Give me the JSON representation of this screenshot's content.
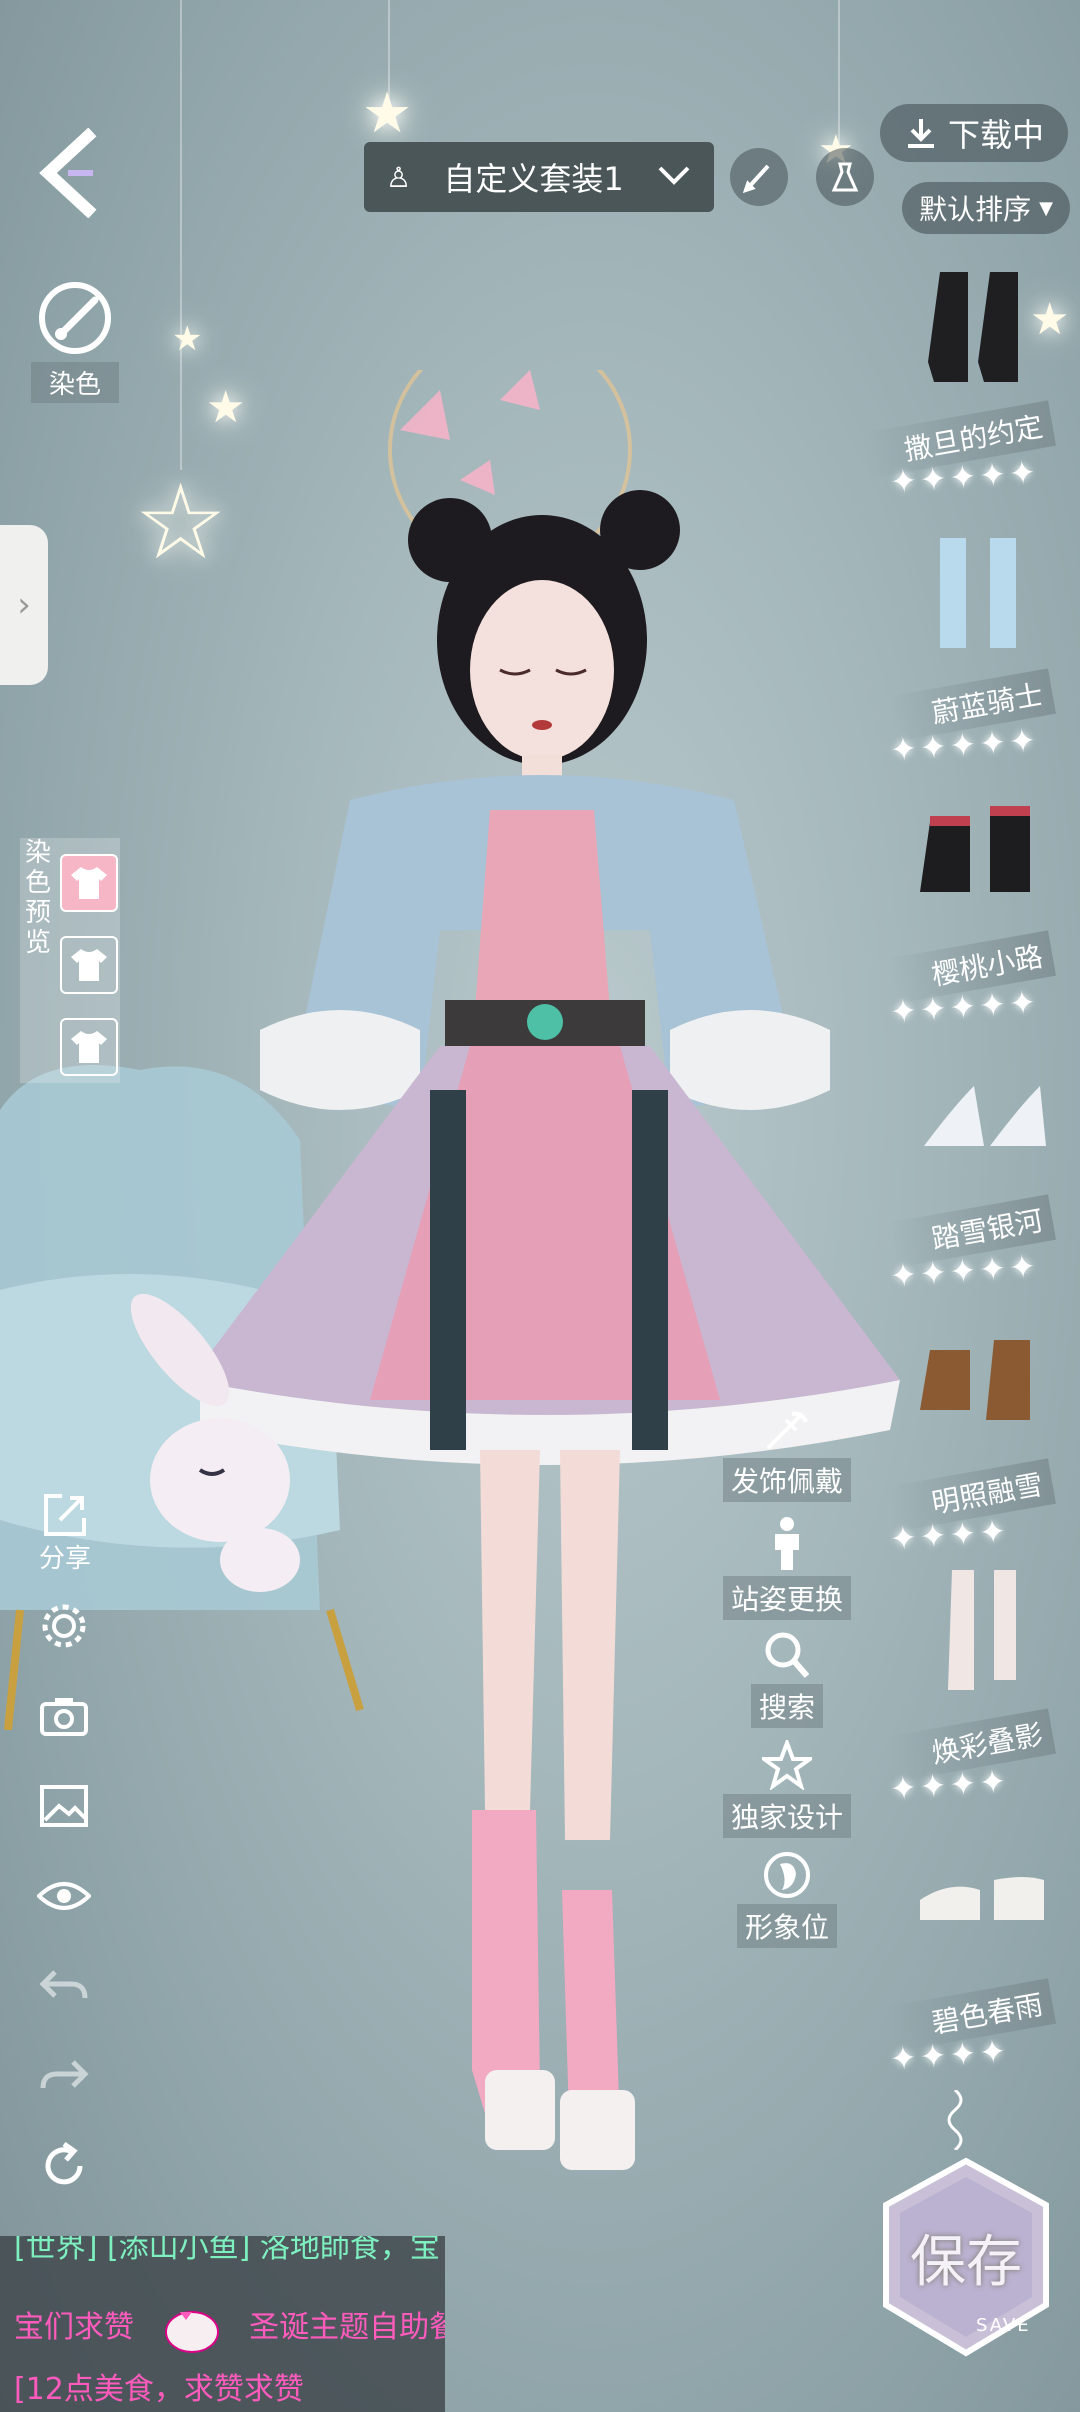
{
  "header": {
    "outfit_name": "自定义套装1",
    "download_label": "下载中",
    "sort_label": "默认排序"
  },
  "left_tools": {
    "dye_label": "染色",
    "dye_preview_title": [
      "染",
      "色",
      "预",
      "览"
    ],
    "share_label": "分享"
  },
  "shoes": [
    {
      "name": "撒旦的约定",
      "stars": 5
    },
    {
      "name": "蔚蓝骑士",
      "stars": 5
    },
    {
      "name": "樱桃小路",
      "stars": 5
    },
    {
      "name": "踏雪银河",
      "stars": 5
    },
    {
      "name": "明照融雪",
      "stars": 4
    },
    {
      "name": "焕彩叠影",
      "stars": 4
    },
    {
      "name": "碧色春雨",
      "stars": 4
    }
  ],
  "mid_tools": {
    "accessory": "发饰佩戴",
    "pose": "站姿更换",
    "search": "搜索",
    "exclusive": "独家设计",
    "avatar": "形象位"
  },
  "chat": {
    "line1": "[世界] [添山小鱼] 洛地師食，宝",
    "line2a": "宝们求赞",
    "line2b": "圣诞主题自助餐",
    "line3": "[12点美食，求赞求赞"
  },
  "save": {
    "label": "保存",
    "sub": "SAVE"
  },
  "colors": {
    "accent_pink": "#ff4fb2",
    "chat_cyan": "#7ef0c0",
    "chat_pink": "#ff5bbd"
  }
}
